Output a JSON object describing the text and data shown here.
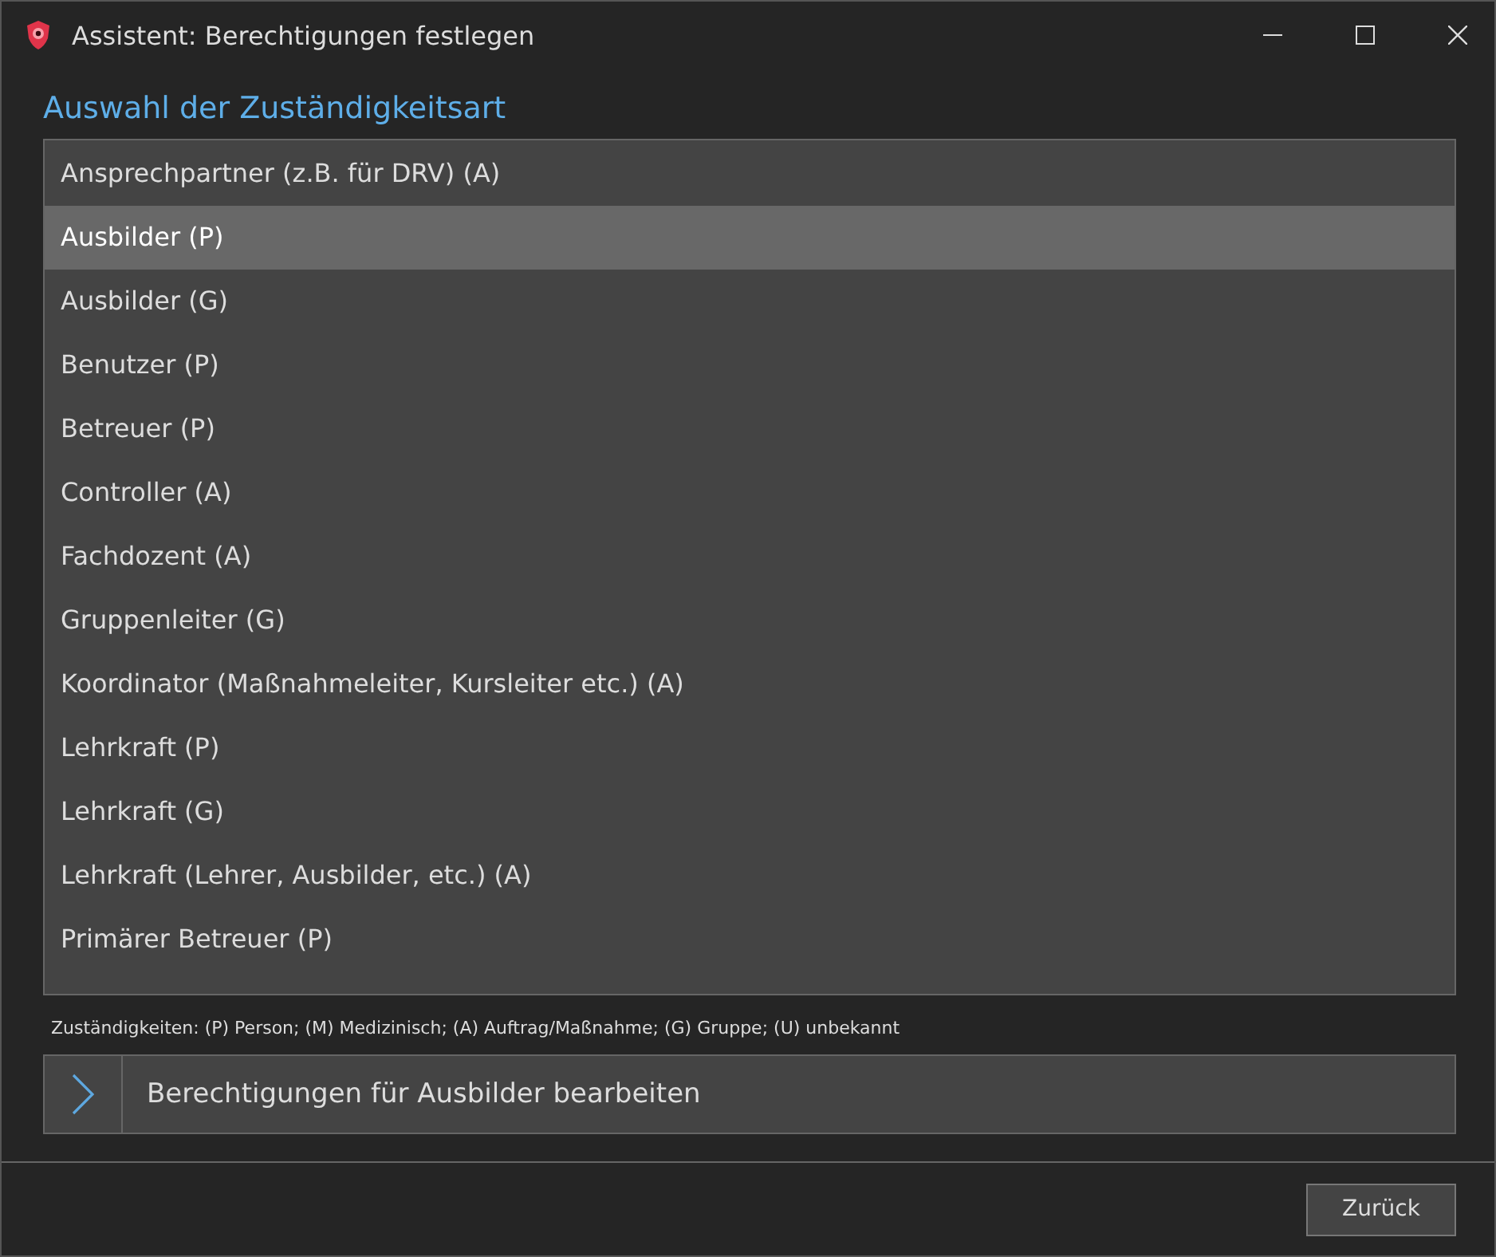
{
  "window": {
    "title": "Assistent: Berechtigungen festlegen"
  },
  "heading": "Auswahl der Zuständigkeitsart",
  "items": [
    {
      "label": "Ansprechpartner (z.B. für DRV) (A)",
      "selected": false
    },
    {
      "label": "Ausbilder (P)",
      "selected": true
    },
    {
      "label": "Ausbilder (G)",
      "selected": false
    },
    {
      "label": "Benutzer (P)",
      "selected": false
    },
    {
      "label": "Betreuer (P)",
      "selected": false
    },
    {
      "label": "Controller (A)",
      "selected": false
    },
    {
      "label": "Fachdozent (A)",
      "selected": false
    },
    {
      "label": "Gruppenleiter (G)",
      "selected": false
    },
    {
      "label": "Koordinator (Maßnahmeleiter, Kursleiter etc.) (A)",
      "selected": false
    },
    {
      "label": "Lehrkraft (P)",
      "selected": false
    },
    {
      "label": "Lehrkraft (G)",
      "selected": false
    },
    {
      "label": "Lehrkraft (Lehrer, Ausbilder, etc.) (A)",
      "selected": false
    },
    {
      "label": "Primärer Betreuer (P)",
      "selected": false
    }
  ],
  "legend": "Zuständigkeiten: (P) Person; (M) Medizinisch; (A) Auftrag/Maßnahme; (G) Gruppe; (U) unbekannt",
  "action": "Berechtigungen für Ausbilder bearbeiten",
  "buttons": [
    "Zurück"
  ]
}
